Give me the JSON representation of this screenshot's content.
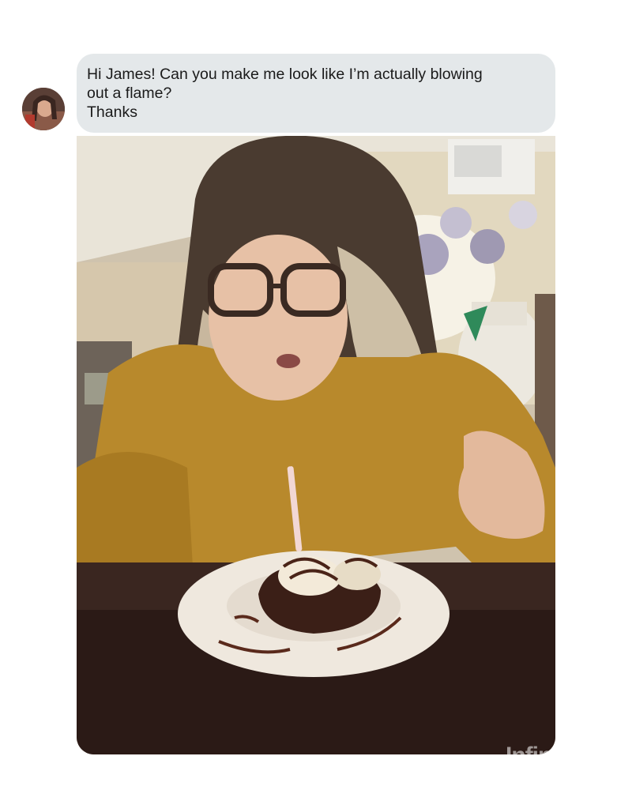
{
  "conversation": {
    "sender_avatar": "avatar-photo",
    "message": {
      "lines": [
        "Hi James! Can you make me look like I’m actually blowing",
        "out a flame?",
        "Thanks"
      ]
    },
    "attachment": {
      "type": "photo",
      "subject": "woman blowing at an unlit candle on a dessert plate"
    }
  },
  "watermark": {
    "text": "InfinOk"
  },
  "colors": {
    "bubble_background": "#e4e8ea",
    "text": "#1a1a1a",
    "page_background": "#ffffff"
  }
}
